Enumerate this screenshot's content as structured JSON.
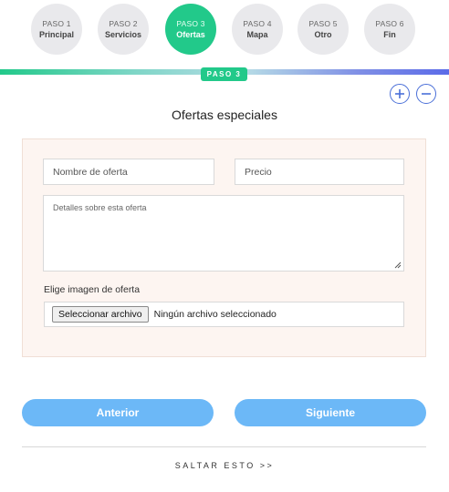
{
  "steps": [
    {
      "num": "PASO 1",
      "name": "Principal"
    },
    {
      "num": "PASO 2",
      "name": "Servicios"
    },
    {
      "num": "PASO 3",
      "name": "Ofertas"
    },
    {
      "num": "PASO 4",
      "name": "Mapa"
    },
    {
      "num": "PASO 5",
      "name": "Otro"
    },
    {
      "num": "PASO 6",
      "name": "Fin"
    }
  ],
  "active_step": 3,
  "step_badge": "PASO 3",
  "section_title": "Ofertas especiales",
  "form": {
    "offer_name_placeholder": "Nombre de oferta",
    "price_placeholder": "Precio",
    "details_placeholder": "Detalles sobre esta oferta",
    "image_label": "Elige imagen de oferta",
    "file_button_label": "Seleccionar archivo",
    "file_status": "Ningún archivo seleccionado"
  },
  "buttons": {
    "previous": "Anterior",
    "next": "Siguiente"
  },
  "skip_label": "SALTAR ESTO >>",
  "colors": {
    "active_step": "#22c98a",
    "nav_button": "#6cb8f7",
    "panel_bg": "#fdf5f1",
    "icon_blue": "#4a6fd8"
  }
}
